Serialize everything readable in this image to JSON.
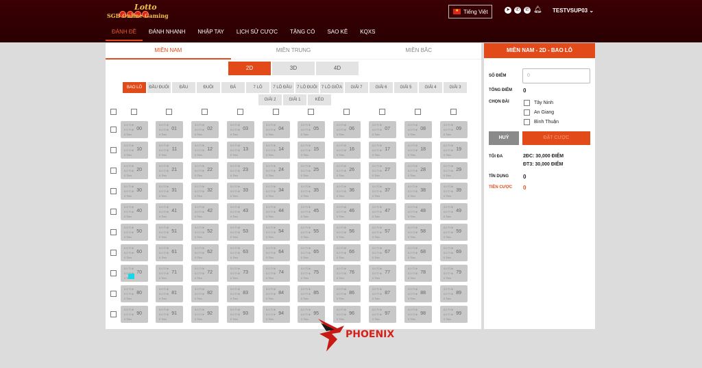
{
  "header": {
    "logo": {
      "top": "Lotto",
      "bottom": "SGB Online Gaming"
    },
    "language": "Tiếng Việt",
    "username": "TESTVSUP03",
    "nav": [
      "ĐÁNH ĐỀ",
      "ĐÁNH NHANH",
      "NHẬP TAY",
      "LỊCH SỬ CƯỢC",
      "TẶNG CÓ",
      "SAO KÊ",
      "KQXS"
    ],
    "nav_active": 0
  },
  "regions": [
    "MIỀN NAM",
    "MIỀN TRUNG",
    "MIỀN BẮC"
  ],
  "digits": [
    "2D",
    "3D",
    "4D"
  ],
  "bet_types": [
    "BAO LÔ",
    "ĐẦU ĐUÔI",
    "ĐẦU",
    "ĐUÔI",
    "ĐÁ",
    "7 LÔ",
    "7 LÔ ĐẦU",
    "7 LÔ ĐUÔI",
    "7 LÔ GIỮA",
    "GIẢI 7",
    "GIẢI 6",
    "GIẢI 5",
    "GIẢI 4",
    "GIẢI 3",
    "GIẢI 2",
    "GIẢI 1",
    "KÈO"
  ],
  "cell_lines": [
    "0.0 Ti lệ",
    "0.0 Ti lệ",
    "0 Tiền"
  ],
  "numbers": [
    "00",
    "01",
    "02",
    "03",
    "04",
    "05",
    "06",
    "07",
    "08",
    "09",
    "10",
    "11",
    "12",
    "13",
    "14",
    "15",
    "16",
    "17",
    "18",
    "19",
    "20",
    "21",
    "22",
    "23",
    "24",
    "25",
    "26",
    "27",
    "28",
    "29",
    "30",
    "31",
    "32",
    "33",
    "34",
    "35",
    "36",
    "37",
    "38",
    "39",
    "40",
    "41",
    "42",
    "43",
    "44",
    "45",
    "46",
    "47",
    "48",
    "49",
    "50",
    "51",
    "52",
    "53",
    "54",
    "55",
    "56",
    "57",
    "58",
    "59",
    "60",
    "61",
    "62",
    "63",
    "64",
    "65",
    "66",
    "67",
    "68",
    "69",
    "70",
    "71",
    "72",
    "73",
    "74",
    "75",
    "76",
    "77",
    "78",
    "79",
    "80",
    "81",
    "82",
    "83",
    "84",
    "85",
    "86",
    "87",
    "88",
    "89",
    "90",
    "91",
    "92",
    "93",
    "94",
    "95",
    "96",
    "97",
    "98",
    "99"
  ],
  "side": {
    "title": "MIỀN NAM - 2D - BAO LÔ",
    "so_diem_label": "SỐ ĐIỂM",
    "so_diem_placeholder": "0",
    "tong_diem_label": "TỔNG ĐIỂM",
    "tong_diem_value": "0",
    "chon_dai_label": "CHỌN ĐÀI",
    "dai": [
      "Tây Ninh",
      "An Giang",
      "Bình Thuận"
    ],
    "cancel_label": "HUỶ",
    "bet_label": "ĐẶT CƯỢC",
    "toi_da_label": "TỐI ĐA",
    "toi_da_lines": [
      "2ĐC: 30,000 ĐIỂM",
      "ĐT3: 30,000 ĐIỂM"
    ],
    "tin_dung_label": "TÍN DỤNG",
    "tin_dung_value": "0",
    "tien_cuoc_label": "TIỀN CƯỢC",
    "tien_cuoc_value": "0"
  },
  "watermark": "PHOENIX",
  "colors": {
    "header_bg": "#2a0002",
    "accent": "#e24a1a",
    "cell": "#c8c8c8"
  }
}
